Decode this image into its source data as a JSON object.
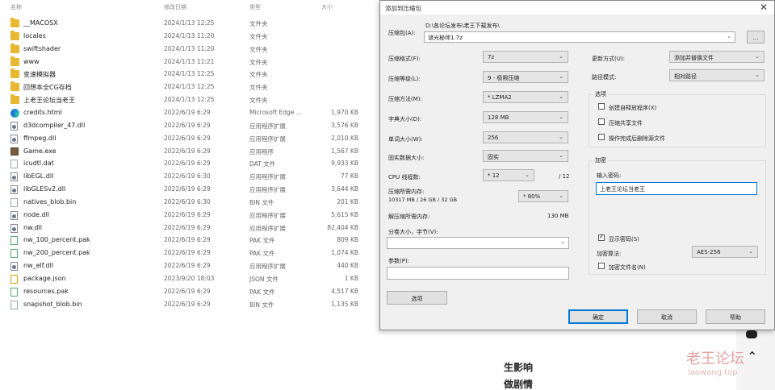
{
  "explorer": {
    "headers": {
      "name": "名称",
      "date": "修改日期",
      "type": "类型",
      "size": "大小"
    },
    "files": [
      {
        "name": "__MACOSX",
        "date": "2024/1/13 12:25",
        "type": "文件夹",
        "size": "",
        "icon": "folder"
      },
      {
        "name": "locales",
        "date": "2024/1/13 11:20",
        "type": "文件夹",
        "size": "",
        "icon": "folder"
      },
      {
        "name": "swiftshader",
        "date": "2024/1/13 11:20",
        "type": "文件夹",
        "size": "",
        "icon": "folder"
      },
      {
        "name": "www",
        "date": "2024/1/13 11:21",
        "type": "文件夹",
        "size": "",
        "icon": "folder"
      },
      {
        "name": "变速模拟器",
        "date": "2024/1/13 12:25",
        "type": "文件夹",
        "size": "",
        "icon": "folder"
      },
      {
        "name": "回想本全CG存档",
        "date": "2024/1/13 12:25",
        "type": "文件夹",
        "size": "",
        "icon": "folder"
      },
      {
        "name": "上老王论坛当老王",
        "date": "2024/1/13 12:25",
        "type": "文件夹",
        "size": "",
        "icon": "folder"
      },
      {
        "name": "credits.html",
        "date": "2022/6/19 6:29",
        "type": "Microsoft Edge ...",
        "size": "1,970 KB",
        "icon": "edge"
      },
      {
        "name": "d3dcompiler_47.dll",
        "date": "2022/6/19 6:29",
        "type": "应用程序扩展",
        "size": "3,576 KB",
        "icon": "gear"
      },
      {
        "name": "ffmpeg.dll",
        "date": "2022/6/19 6:29",
        "type": "应用程序扩展",
        "size": "2,010 KB",
        "icon": "gear"
      },
      {
        "name": "Game.exe",
        "date": "2022/6/19 6:29",
        "type": "应用程序",
        "size": "1,567 KB",
        "icon": "exe"
      },
      {
        "name": "icudtl.dat",
        "date": "2022/6/19 6:29",
        "type": "DAT 文件",
        "size": "9,933 KB",
        "icon": "file"
      },
      {
        "name": "libEGL.dll",
        "date": "2022/6/19 6:30",
        "type": "应用程序扩展",
        "size": "77 KB",
        "icon": "gear"
      },
      {
        "name": "libGLESv2.dll",
        "date": "2022/6/19 6:29",
        "type": "应用程序扩展",
        "size": "3,644 KB",
        "icon": "gear"
      },
      {
        "name": "natives_blob.bin",
        "date": "2022/6/19 6:30",
        "type": "BIN 文件",
        "size": "201 KB",
        "icon": "file"
      },
      {
        "name": "node.dll",
        "date": "2022/6/19 6:29",
        "type": "应用程序扩展",
        "size": "5,615 KB",
        "icon": "gear"
      },
      {
        "name": "nw.dll",
        "date": "2022/6/19 6:29",
        "type": "应用程序扩展",
        "size": "82,404 KB",
        "icon": "gear"
      },
      {
        "name": "nw_100_percent.pak",
        "date": "2022/6/19 6:29",
        "type": "PAK 文件",
        "size": "809 KB",
        "icon": "pak"
      },
      {
        "name": "nw_200_percent.pak",
        "date": "2022/6/19 6:29",
        "type": "PAK 文件",
        "size": "1,074 KB",
        "icon": "pak"
      },
      {
        "name": "nw_elf.dll",
        "date": "2022/6/19 6:29",
        "type": "应用程序扩展",
        "size": "440 KB",
        "icon": "gear"
      },
      {
        "name": "package.json",
        "date": "2023/9/20 18:03",
        "type": "JSON 文件",
        "size": "1 KB",
        "icon": "json"
      },
      {
        "name": "resources.pak",
        "date": "2022/6/19 6:29",
        "type": "PAK 文件",
        "size": "4,517 KB",
        "icon": "pak"
      },
      {
        "name": "snapshot_blob.bin",
        "date": "2022/6/19 6:29",
        "type": "BIN 文件",
        "size": "1,135 KB",
        "icon": "file"
      }
    ]
  },
  "dialog": {
    "title": "添加到压缩包",
    "close": "✕",
    "archive_label": "压缩包(A):",
    "archive_path": "D:\\各论坛发布\\老王下载发布\\",
    "archive_name": "谜光秘师1.7z",
    "browse": "...",
    "format_label": "压缩格式(F):",
    "format_value": "7z",
    "level_label": "压缩等级(L):",
    "level_value": "9 - 极限压缩",
    "method_label": "压缩方法(M):",
    "method_value": "* LZMA2",
    "dict_label": "字典大小(D):",
    "dict_value": "128 MB",
    "word_label": "单词大小(W):",
    "word_value": "256",
    "solid_label": "固实数据大小:",
    "solid_value": "固实",
    "threads_label": "CPU 线程数:",
    "threads_value": "* 12",
    "threads_max": "/ 12",
    "mem_label": "压缩所需内存:",
    "mem_detail": "10317 MB / 26 GB / 32 GB",
    "mem_value": "* 80%",
    "decomp_label": "解压缩所需内存:",
    "decomp_value": "130 MB",
    "split_label": "分卷大小，字节(V):",
    "params_label": "参数(P):",
    "options_btn": "选项",
    "update_label": "更新方式(U):",
    "update_value": "添加并替换文件",
    "pathmode_label": "路径模式:",
    "pathmode_value": "相对路径",
    "options_group": "选项",
    "opt_sfx": "创建自释放程序(X)",
    "opt_shared": "压缩共享文件",
    "opt_delete": "操作完成后删除源文件",
    "enc_group": "加密",
    "pwd_label": "输入密码:",
    "pwd_value": "上老王论坛当老王",
    "show_pwd": "显示密码(S)",
    "enc_method_label": "加密算法:",
    "enc_method_value": "AES-256",
    "enc_names": "加密文件名(N)",
    "ok": "确定",
    "cancel": "取消",
    "help": "帮助"
  },
  "background": {
    "text1": "生影响",
    "text2": "做剧情",
    "watermark": "老王论坛",
    "watermark_url": "laowang.top"
  }
}
